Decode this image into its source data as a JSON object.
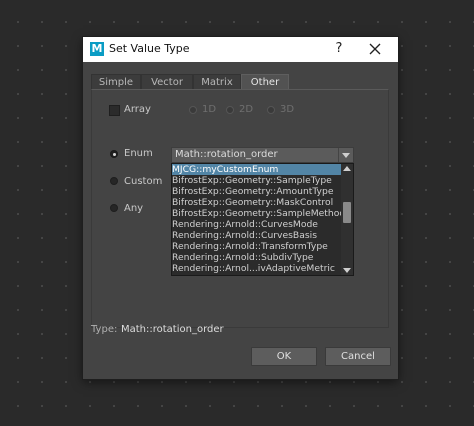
{
  "dialog": {
    "title": "Set Value Type",
    "logo_letter": "M",
    "help_label": "?",
    "close_icon": "close-icon"
  },
  "tabs": [
    {
      "label": "Simple",
      "active": false
    },
    {
      "label": "Vector",
      "active": false
    },
    {
      "label": "Matrix",
      "active": false
    },
    {
      "label": "Other",
      "active": true
    }
  ],
  "array": {
    "label": "Array",
    "checked": false,
    "dims": [
      "1D",
      "2D",
      "3D"
    ]
  },
  "options": {
    "enum_label": "Enum",
    "custom_label": "Custom",
    "any_label": "Any",
    "selected": "Enum"
  },
  "enum_combo": {
    "value": "Math::rotation_order"
  },
  "enum_list": {
    "items": [
      "MJCG::myCustomEnum",
      "BifrostExp::Geometry::SampleType",
      "BifrostExp::Geometry::AmountType",
      "BifrostExp::Geometry::MaskControl",
      "BifrostExp::Geometry::SampleMethod",
      "Rendering::Arnold::CurvesMode",
      "Rendering::Arnold::CurvesBasis",
      "Rendering::Arnold::TransformType",
      "Rendering::Arnold::SubdivType",
      "Rendering::Arnol...ivAdaptiveMetric"
    ],
    "selected_index": 0
  },
  "type_info": {
    "label": "Type:",
    "value": "Math::rotation_order"
  },
  "buttons": {
    "ok": "OK",
    "cancel": "Cancel"
  },
  "colors": {
    "accent_logo": "#0a9cc4",
    "selection": "#5285a6",
    "dialog_bg": "#444444"
  }
}
